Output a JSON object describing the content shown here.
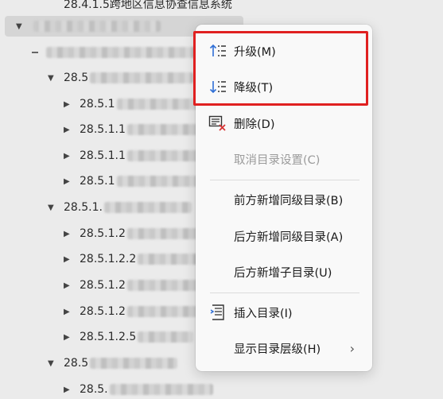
{
  "tree": {
    "top_label": "28.4.1.5跨地区信息协查信息系统",
    "nodes": [
      {
        "label": "28.5",
        "kind": "expanded"
      },
      {
        "label": "28.5.1",
        "kind": "collapsed"
      },
      {
        "label": "28.5.1.1",
        "kind": "collapsed"
      },
      {
        "label": "28.5.1.1",
        "kind": "collapsed"
      },
      {
        "label": "28.5.1",
        "kind": "collapsed"
      },
      {
        "label": "28.5.1.",
        "kind": "expanded"
      },
      {
        "label": "28.5.1.2",
        "kind": "collapsed"
      },
      {
        "label": "28.5.1.2.2",
        "kind": "collapsed"
      },
      {
        "label": "28.5.1.2",
        "kind": "collapsed"
      },
      {
        "label": "28.5.1.2",
        "kind": "collapsed"
      },
      {
        "label": "28.5.1.2.5",
        "kind": "collapsed"
      },
      {
        "label": "28.5",
        "kind": "expanded"
      },
      {
        "label": "28.5.",
        "kind": "collapsed"
      }
    ]
  },
  "menu": {
    "promote": {
      "label": "升级(M)",
      "icon": "promote-icon"
    },
    "demote": {
      "label": "降级(T)",
      "icon": "demote-icon"
    },
    "delete": {
      "label": "删除(D)",
      "icon": "delete-icon"
    },
    "cancel_toc": {
      "label": "取消目录设置(C)"
    },
    "add_sibling_before": {
      "label": "前方新增同级目录(B)"
    },
    "add_sibling_after": {
      "label": "后方新增同级目录(A)"
    },
    "add_child_after": {
      "label": "后方新增子目录(U)"
    },
    "insert_toc": {
      "label": "插入目录(I)",
      "icon": "insert-toc-icon"
    },
    "show_levels": {
      "label": "显示目录层级(H)",
      "icon": "chevron-right-icon"
    }
  },
  "colors": {
    "highlight": "#e02020",
    "icon_blue": "#2f6fd6",
    "icon_red": "#d93636"
  }
}
